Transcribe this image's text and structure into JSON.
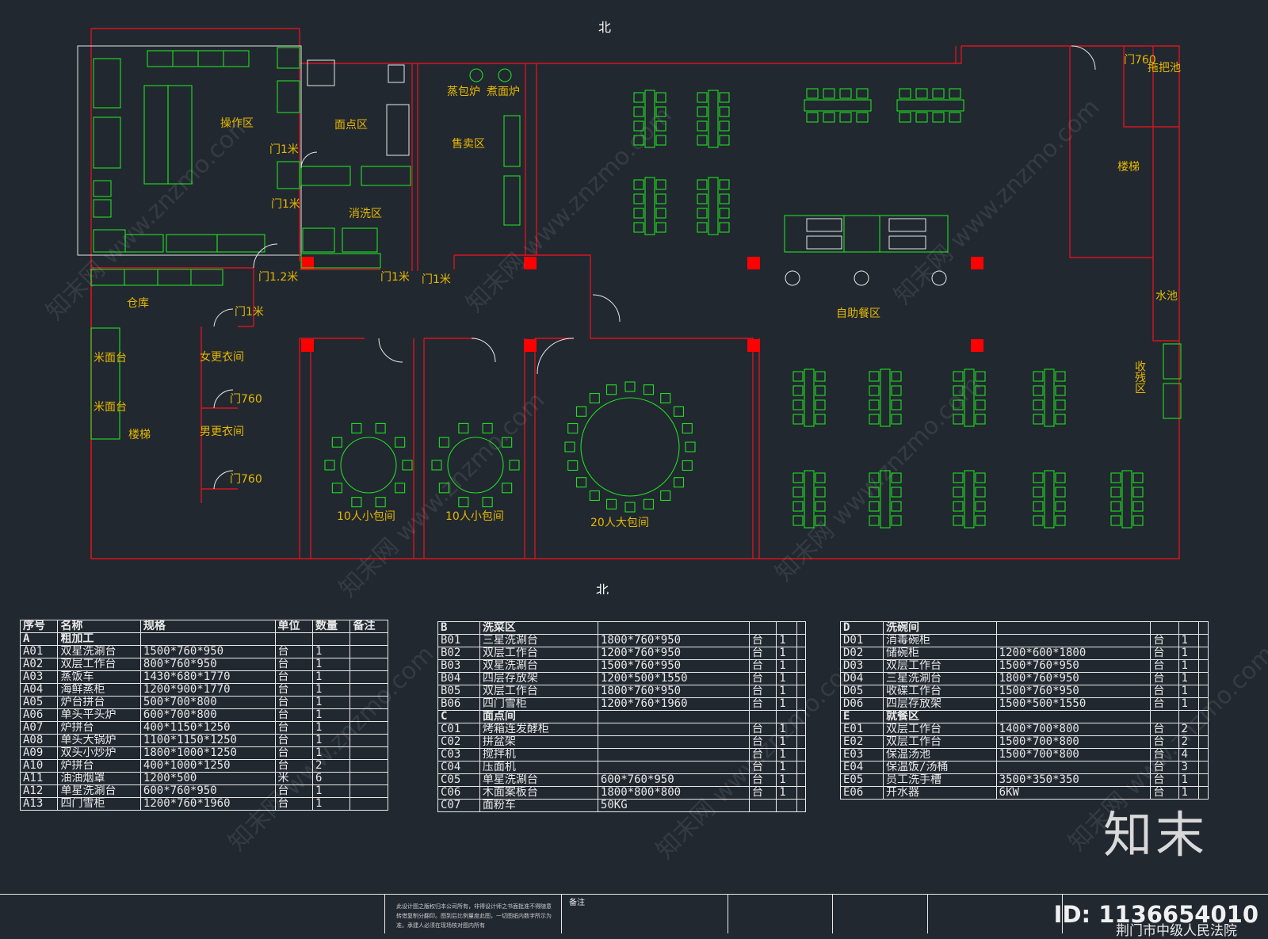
{
  "drawing": {
    "north_label": "北",
    "rooms": {
      "operation": "操作区",
      "pastry": "面点区",
      "steam_stove": "蒸包炉",
      "boil_stove": "煮面炉",
      "sales": "售卖区",
      "wash": "消洗区",
      "storage": "仓库",
      "rice1": "米面台",
      "rice2": "米面台",
      "stairs_left": "楼梯",
      "female_locker": "女更衣间",
      "male_locker": "男更衣间",
      "small_room_1": "10人小包间",
      "small_room_2": "10人小包间",
      "large_room": "20人大包间",
      "buffet": "自助餐区",
      "stairs_right": "楼梯",
      "mop_pool": "拖把池",
      "water_pool": "水池",
      "leftover": "收残区"
    },
    "doors": {
      "d1": "门1米",
      "d2": "门1米",
      "d3": "门1.2米",
      "d4": "门1米",
      "d5": "门1米",
      "d6": "门1米",
      "d7": "门760",
      "d8": "门760",
      "d9": "门760"
    }
  },
  "schedule_a": {
    "headers": [
      "序号",
      "名称",
      "规格",
      "单位",
      "数量",
      "备注"
    ],
    "section": {
      "code": "A",
      "name": "粗加工"
    },
    "rows": [
      [
        "A01",
        "双星洗涮台",
        "1500*760*950",
        "台",
        "1"
      ],
      [
        "A02",
        "双层工作台",
        "800*760*950",
        "台",
        "1"
      ],
      [
        "A03",
        "蒸饭车",
        "1430*680*1770",
        "台",
        "1"
      ],
      [
        "A04",
        "海鲜蒸柜",
        "1200*900*1770",
        "台",
        "1"
      ],
      [
        "A05",
        "炉台拼台",
        "500*700*800",
        "台",
        "1"
      ],
      [
        "A06",
        "单头平头炉",
        "600*700*800",
        "台",
        "1"
      ],
      [
        "A07",
        "炉拼台",
        "400*1150*1250",
        "台",
        "1"
      ],
      [
        "A08",
        "单头大锅炉",
        "1100*1150*1250",
        "台",
        "1"
      ],
      [
        "A09",
        "双头小炒炉",
        "1800*1000*1250",
        "台",
        "1"
      ],
      [
        "A10",
        "炉拼台",
        "400*1000*1250",
        "台",
        "2"
      ],
      [
        "A11",
        "油油烟罩",
        "1200*500",
        "米",
        "6"
      ],
      [
        "A12",
        "单星洗涮台",
        "600*760*950",
        "台",
        "1"
      ],
      [
        "A13",
        "四门雪柜",
        "1200*760*1960",
        "台",
        "1"
      ]
    ]
  },
  "schedule_b": {
    "sections": [
      {
        "code": "B",
        "name": "洗菜区",
        "rows": [
          [
            "B01",
            "三星洗涮台",
            "1800*760*950",
            "台",
            "1"
          ],
          [
            "B02",
            "双层工作台",
            "1200*760*950",
            "台",
            "1"
          ],
          [
            "B03",
            "双星洗涮台",
            "1500*760*950",
            "台",
            "1"
          ],
          [
            "B04",
            "四层存放架",
            "1200*500*1550",
            "台",
            "1"
          ],
          [
            "B05",
            "双层工作台",
            "1800*760*950",
            "台",
            "1"
          ],
          [
            "B06",
            "四门雪柜",
            "1200*760*1960",
            "台",
            "1"
          ]
        ]
      },
      {
        "code": "C",
        "name": "面点间",
        "rows": [
          [
            "C01",
            "烤箱连发酵柜",
            "",
            "台",
            "1"
          ],
          [
            "C02",
            "拼盆架",
            "",
            "台",
            "1"
          ],
          [
            "C03",
            "搅拌机",
            "",
            "台",
            "1"
          ],
          [
            "C04",
            "压面机",
            "",
            "台",
            "1"
          ],
          [
            "C05",
            "单星洗涮台",
            "600*760*950",
            "台",
            "1"
          ],
          [
            "C06",
            "木面案板台",
            "1800*800*800",
            "台",
            "1"
          ],
          [
            "C07",
            "面粉车",
            "50KG",
            "",
            ""
          ]
        ]
      }
    ]
  },
  "schedule_c": {
    "sections": [
      {
        "code": "D",
        "name": "洗碗间",
        "rows": [
          [
            "D01",
            "消毒碗柜",
            "",
            "台",
            "1"
          ],
          [
            "D02",
            "储碗柜",
            "1200*600*1800",
            "台",
            "1"
          ],
          [
            "D03",
            "双层工作台",
            "1500*760*950",
            "台",
            "1"
          ],
          [
            "D04",
            "三星洗涮台",
            "1800*760*950",
            "台",
            "1"
          ],
          [
            "D05",
            "收碟工作台",
            "1500*760*950",
            "台",
            "1"
          ],
          [
            "D06",
            "四层存放架",
            "1500*500*1550",
            "台",
            "1"
          ]
        ]
      },
      {
        "code": "E",
        "name": "就餐区",
        "rows": [
          [
            "E01",
            "双层工作台",
            "1400*700*800",
            "台",
            "2"
          ],
          [
            "E02",
            "双层工作台",
            "1500*700*800",
            "台",
            "2"
          ],
          [
            "E03",
            "保温汤池",
            "1500*700*800",
            "台",
            "4"
          ],
          [
            "E04",
            "保温饭/汤桶",
            "",
            "台",
            "3"
          ],
          [
            "E05",
            "员工洗手槽",
            "3500*350*350",
            "台",
            "1"
          ],
          [
            "E06",
            "开水器",
            "6KW",
            "台",
            "1"
          ]
        ]
      }
    ]
  },
  "titleblock": {
    "remark": "备注",
    "note": "此设计图之版权归本公司所有，非得设计师之书面批准不得随意转借复制分翻印。图到后比例量度此图，一切图纸内数字所示为准。承建人必须在现场核对图内所有",
    "project_name": "荆门市中级人民法院"
  },
  "watermark": {
    "text": "知末网 www.znzmo.com",
    "logo": "知末",
    "id": "ID: 1136654010"
  },
  "colors": {
    "background": "#212830",
    "wall": "#d8141e",
    "equipment": "#22dd22",
    "label": "#e6b800",
    "column": "#ff0000"
  }
}
